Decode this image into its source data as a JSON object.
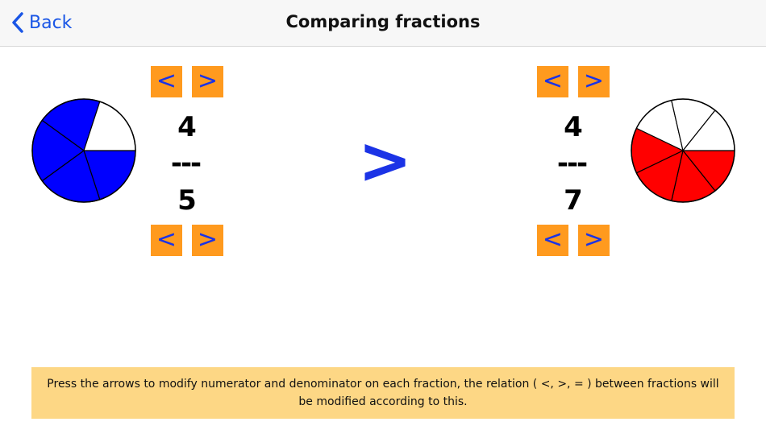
{
  "nav": {
    "back_label": "Back",
    "title": "Comparing fractions"
  },
  "arrows": {
    "decrease": "<",
    "increase": ">"
  },
  "left_fraction": {
    "numerator": "4",
    "bar": "---",
    "denominator": "5",
    "fill_color": "#0000ff"
  },
  "right_fraction": {
    "numerator": "4",
    "bar": "---",
    "denominator": "7",
    "fill_color": "#ff0000"
  },
  "relation": ">",
  "hint": "Press the arrows to modify numerator and denominator on each fraction, the relation ( <, >, = ) between fractions will be modified according to this."
}
